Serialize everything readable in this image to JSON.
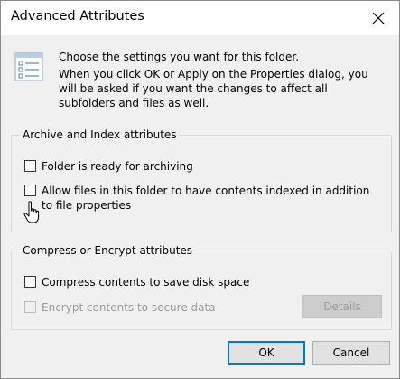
{
  "window": {
    "title": "Advanced Attributes"
  },
  "intro": {
    "line1": "Choose the settings you want for this folder.",
    "line2": "When you click OK or Apply on the Properties dialog, you will be asked if you want the changes to affect all subfolders and files as well."
  },
  "archive_group": {
    "label": "Archive and Index attributes",
    "options": [
      {
        "label": "Folder is ready for archiving",
        "checked": false,
        "enabled": true
      },
      {
        "label": "Allow files in this folder to have contents indexed in addition to file properties",
        "checked": false,
        "enabled": true
      }
    ]
  },
  "compress_group": {
    "label": "Compress or Encrypt attributes",
    "options": [
      {
        "label": "Compress contents to save disk space",
        "checked": false,
        "enabled": true
      },
      {
        "label": "Encrypt contents to secure data",
        "checked": false,
        "enabled": false
      }
    ],
    "details_label": "Details"
  },
  "buttons": {
    "ok": "OK",
    "cancel": "Cancel"
  },
  "icons": {
    "close": "close-icon",
    "settings_list": "settings-list-icon",
    "cursor": "hand-pointer-icon"
  },
  "colors": {
    "default_button_border": "#0078d7",
    "dialog_bg": "#f0f0f0"
  }
}
